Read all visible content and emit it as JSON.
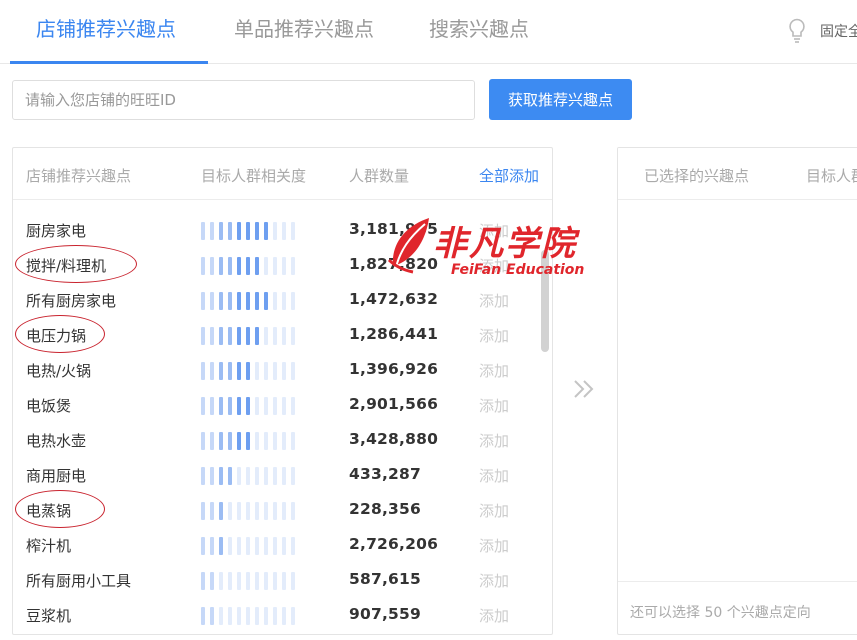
{
  "tabs": [
    {
      "label": "店铺推荐兴趣点",
      "active": true
    },
    {
      "label": "单品推荐兴趣点",
      "active": false
    },
    {
      "label": "搜索兴趣点",
      "active": false
    }
  ],
  "pin": {
    "icon": "lightbulb-icon",
    "label": "固定全"
  },
  "search": {
    "placeholder": "请输入您店铺的旺旺ID",
    "value": "",
    "button_label": "获取推荐兴趣点"
  },
  "left_panel": {
    "headers": {
      "name": "店铺推荐兴趣点",
      "relevance": "目标人群相关度",
      "count": "人群数量",
      "add_all": "全部添加"
    },
    "add_label": "添加",
    "rows": [
      {
        "name": "厨房家电",
        "relevance_level": 8,
        "count": "3,181,985",
        "circled": false
      },
      {
        "name": "搅拌/料理机",
        "relevance_level": 7,
        "count": "1,827,820",
        "circled": true
      },
      {
        "name": "所有厨房家电",
        "relevance_level": 8,
        "count": "1,472,632",
        "circled": false
      },
      {
        "name": "电压力锅",
        "relevance_level": 7,
        "count": "1,286,441",
        "circled": true
      },
      {
        "name": "电热/火锅",
        "relevance_level": 6,
        "count": "1,396,926",
        "circled": false
      },
      {
        "name": "电饭煲",
        "relevance_level": 6,
        "count": "2,901,566",
        "circled": false
      },
      {
        "name": "电热水壶",
        "relevance_level": 6,
        "count": "3,428,880",
        "circled": false
      },
      {
        "name": "商用厨电",
        "relevance_level": 4,
        "count": "433,287",
        "circled": false
      },
      {
        "name": "电蒸锅",
        "relevance_level": 3,
        "count": "228,356",
        "circled": true
      },
      {
        "name": "榨汁机",
        "relevance_level": 3,
        "count": "2,726,206",
        "circled": false
      },
      {
        "name": "所有厨用小工具",
        "relevance_level": 2,
        "count": "587,615",
        "circled": false
      },
      {
        "name": "豆浆机",
        "relevance_level": 2,
        "count": "907,559",
        "circled": false
      }
    ]
  },
  "right_panel": {
    "headers": {
      "selected": "已选择的兴趣点",
      "relevance": "目标人群"
    },
    "footer_text": "还可以选择 50 个兴趣点定向"
  },
  "watermark": {
    "title": "非凡学院",
    "subtitle": "FeiFan Education"
  },
  "colors": {
    "accent": "#3b86f0",
    "bar_active": "#6e9ff0",
    "bar_inactive": "#e3ecfb",
    "circle": "#c9242f",
    "watermark": "#e0262c"
  }
}
